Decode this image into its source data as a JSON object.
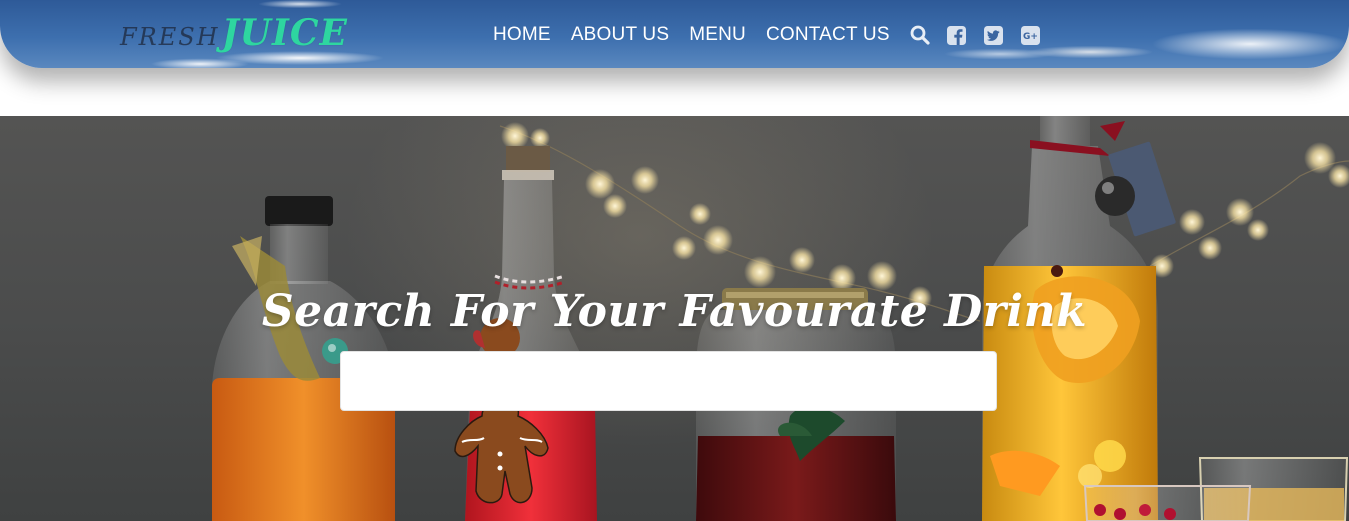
{
  "brand": {
    "part1": "FRESH",
    "part2": "JUICE",
    "accent_color": "#2ed6a0"
  },
  "nav": {
    "items": [
      {
        "label": "HOME"
      },
      {
        "label": "ABOUT US"
      },
      {
        "label": "MENU"
      },
      {
        "label": "CONTACT US"
      }
    ],
    "icons": [
      "search-icon",
      "facebook-icon",
      "twitter-icon",
      "google-plus-icon"
    ]
  },
  "hero": {
    "title": "Search For Your Favourate Drink",
    "search": {
      "value": "",
      "placeholder": ""
    }
  }
}
